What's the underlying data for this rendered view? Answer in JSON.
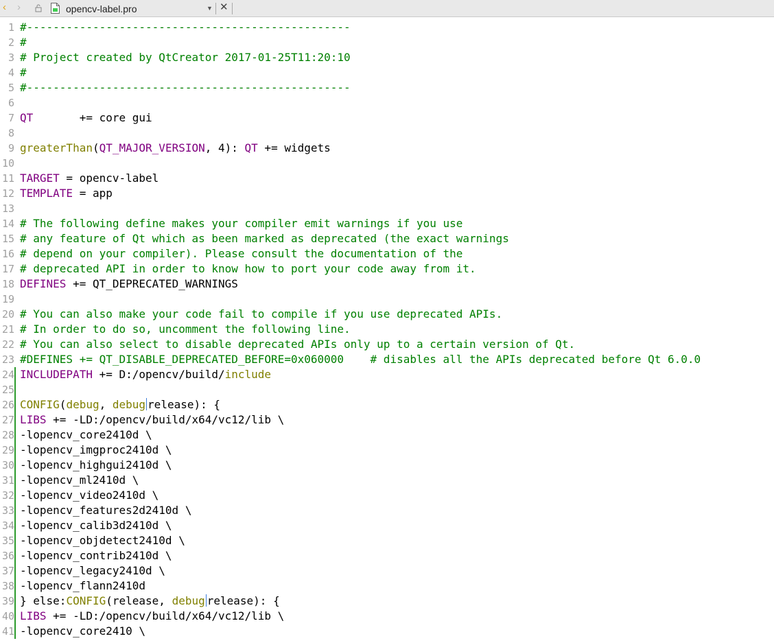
{
  "tab": {
    "title": "opencv-label.pro",
    "back_glyph": "‹",
    "forward_glyph": "›",
    "dropdown_glyph": "▼",
    "close_glyph": "✕",
    "lock_icon": "lock-icon",
    "file_icon": "qt-pro-file-icon"
  },
  "colors": {
    "comment": "#008000",
    "keyword": "#800080",
    "function": "#808000",
    "line_number": "#a0a0a0",
    "change_marker": "#2b9a2b"
  },
  "lines": [
    {
      "n": "1",
      "text": "#-------------------------------------------------",
      "type": "comment"
    },
    {
      "n": "2",
      "text": "#",
      "type": "comment"
    },
    {
      "n": "3",
      "text": "# Project created by QtCreator 2017-01-25T11:20:10",
      "type": "comment"
    },
    {
      "n": "4",
      "text": "#",
      "type": "comment"
    },
    {
      "n": "5",
      "text": "#-------------------------------------------------",
      "type": "comment"
    },
    {
      "n": "6",
      "text": "",
      "type": "plain"
    },
    {
      "n": "7",
      "kw": "QT",
      "rest": "       += core gui",
      "type": "kwline"
    },
    {
      "n": "8",
      "text": "",
      "type": "plain"
    },
    {
      "n": "9",
      "fn": "greaterThan",
      "p1": "(",
      "kw1": "QT_MAJOR_VERSION",
      "p2": ", 4): ",
      "kw2": "QT",
      "rest": " += widgets",
      "type": "line9"
    },
    {
      "n": "10",
      "text": "",
      "type": "plain"
    },
    {
      "n": "11",
      "kw": "TARGET",
      "rest": " = opencv-label",
      "type": "kwline"
    },
    {
      "n": "12",
      "kw": "TEMPLATE",
      "rest": " = app",
      "type": "kwline"
    },
    {
      "n": "13",
      "text": "",
      "type": "plain"
    },
    {
      "n": "14",
      "text": "# The following define makes your compiler emit warnings if you use",
      "type": "comment"
    },
    {
      "n": "15",
      "text": "# any feature of Qt which as been marked as deprecated (the exact warnings",
      "type": "comment"
    },
    {
      "n": "16",
      "text": "# depend on your compiler). Please consult the documentation of the",
      "type": "comment"
    },
    {
      "n": "17",
      "text": "# deprecated API in order to know how to port your code away from it.",
      "type": "comment"
    },
    {
      "n": "18",
      "kw": "DEFINES",
      "rest": " += QT_DEPRECATED_WARNINGS",
      "type": "kwline"
    },
    {
      "n": "19",
      "text": "",
      "type": "plain"
    },
    {
      "n": "20",
      "text": "# You can also make your code fail to compile if you use deprecated APIs.",
      "type": "comment"
    },
    {
      "n": "21",
      "text": "# In order to do so, uncomment the following line.",
      "type": "comment"
    },
    {
      "n": "22",
      "text": "# You can also select to disable deprecated APIs only up to a certain version of Qt.",
      "type": "comment"
    },
    {
      "n": "23",
      "text": "#DEFINES += QT_DISABLE_DEPRECATED_BEFORE=0x060000    # disables all the APIs deprecated before Qt 6.0.0",
      "type": "comment"
    },
    {
      "n": "24",
      "kw": "INCLUDEPATH",
      "rest": " += D:/opencv/build/",
      "fn": "include",
      "type": "line24"
    },
    {
      "n": "25",
      "text": "",
      "type": "plain"
    },
    {
      "n": "26",
      "fn0": "CONFIG",
      "a": "(",
      "fn1": "debug",
      "b": ", ",
      "fn2": "debug",
      "c": "release): {",
      "type": "config"
    },
    {
      "n": "27",
      "kw": "LIBS",
      "rest": " += -LD:/opencv/build/x64/vc12/lib \\",
      "type": "kwline"
    },
    {
      "n": "28",
      "text": "-lopencv_core2410d \\",
      "type": "plain"
    },
    {
      "n": "29",
      "text": "-lopencv_imgproc2410d \\",
      "type": "plain"
    },
    {
      "n": "30",
      "text": "-lopencv_highgui2410d \\",
      "type": "plain"
    },
    {
      "n": "31",
      "text": "-lopencv_ml2410d \\",
      "type": "plain"
    },
    {
      "n": "32",
      "text": "-lopencv_video2410d \\",
      "type": "plain"
    },
    {
      "n": "33",
      "text": "-lopencv_features2d2410d \\",
      "type": "plain"
    },
    {
      "n": "34",
      "text": "-lopencv_calib3d2410d \\",
      "type": "plain"
    },
    {
      "n": "35",
      "text": "-lopencv_objdetect2410d \\",
      "type": "plain"
    },
    {
      "n": "36",
      "text": "-lopencv_contrib2410d \\",
      "type": "plain"
    },
    {
      "n": "37",
      "text": "-lopencv_legacy2410d \\",
      "type": "plain"
    },
    {
      "n": "38",
      "text": "-lopencv_flann2410d",
      "type": "plain"
    },
    {
      "n": "39",
      "pre": "} else:",
      "fn0": "CONFIG",
      "a": "(release, ",
      "fn2": "debug",
      "c": "release): {",
      "type": "elseconfig"
    },
    {
      "n": "40",
      "kw": "LIBS",
      "rest": " += -LD:/opencv/build/x64/vc12/lib \\",
      "type": "kwline"
    },
    {
      "n": "41",
      "text": "-lopencv_core2410 \\",
      "type": "plain"
    }
  ],
  "edited_from": 24
}
